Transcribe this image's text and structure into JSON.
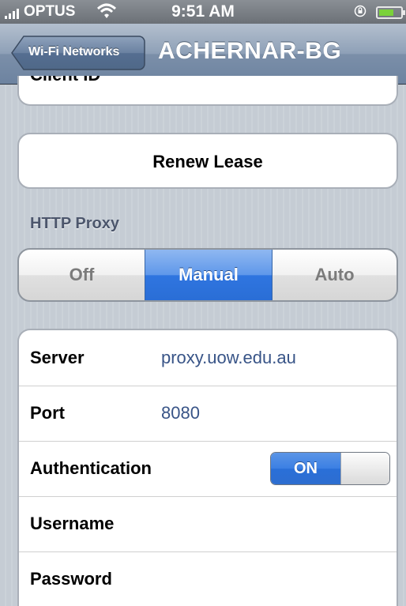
{
  "status_bar": {
    "carrier": "OPTUS",
    "time": "9:51 AM",
    "signal_icon": "signal-bars-icon",
    "wifi_icon": "wifi-icon",
    "lock_icon": "orientation-lock-icon",
    "battery_icon": "battery-icon"
  },
  "nav_bar": {
    "back_label": "Wi-Fi Networks",
    "title": "ACHERNAR-BG"
  },
  "client_id": {
    "label": "Client ID"
  },
  "renew_lease": {
    "label": "Renew Lease"
  },
  "http_proxy": {
    "header": "HTTP Proxy",
    "segments": [
      {
        "label": "Off",
        "selected": false
      },
      {
        "label": "Manual",
        "selected": true
      },
      {
        "label": "Auto",
        "selected": false
      }
    ]
  },
  "proxy_settings": {
    "server": {
      "label": "Server",
      "value": "proxy.uow.edu.au"
    },
    "port": {
      "label": "Port",
      "value": "8080"
    },
    "authentication": {
      "label": "Authentication",
      "toggle_label": "ON",
      "enabled": true
    },
    "username": {
      "label": "Username",
      "value": ""
    },
    "password": {
      "label": "Password",
      "value": ""
    }
  },
  "colors": {
    "selected_blue": "#2f75e0",
    "value_text": "#385487",
    "background": "#c5ccd4"
  }
}
